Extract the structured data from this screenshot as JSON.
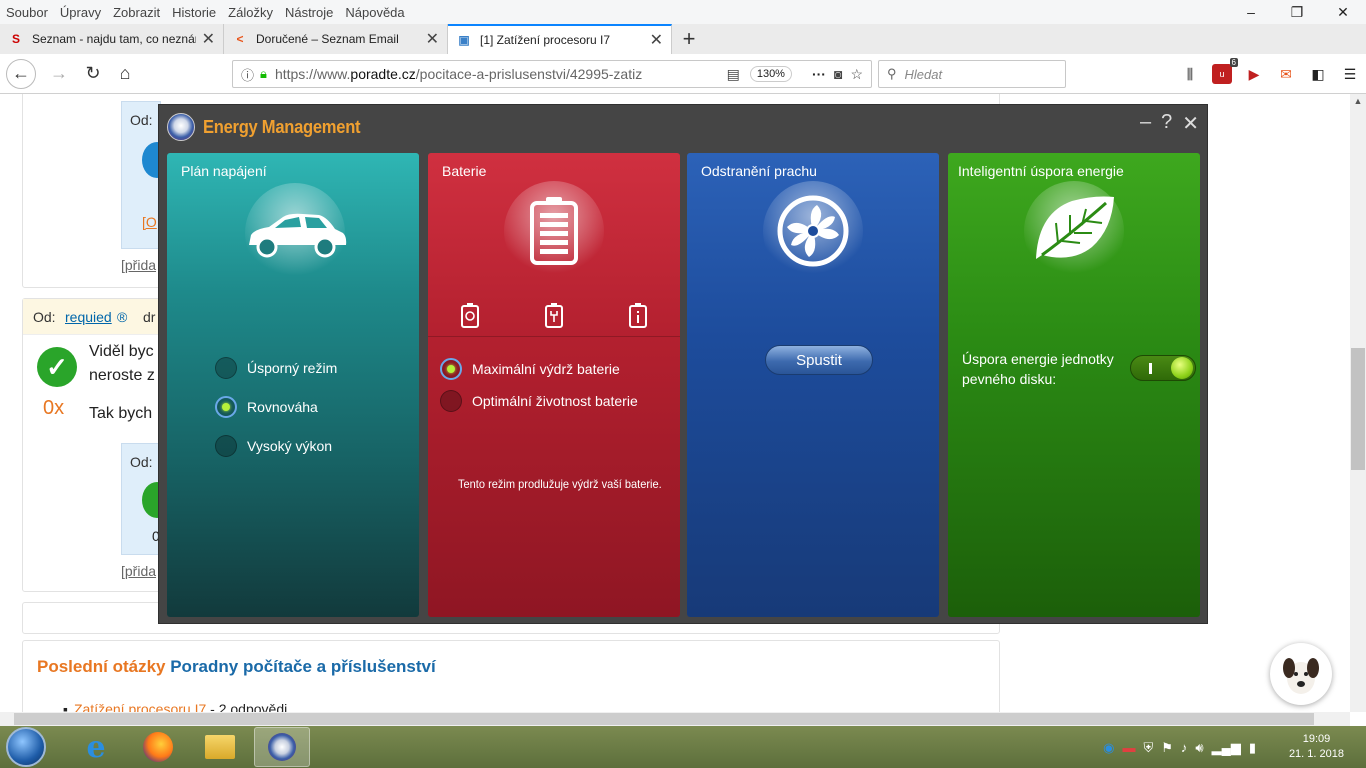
{
  "menubar": {
    "items": [
      "Soubor",
      "Úpravy",
      "Zobrazit",
      "Historie",
      "Záložky",
      "Nástroje",
      "Nápověda"
    ]
  },
  "window_controls": {
    "minimize": "–",
    "maximize": "❐",
    "close": "✕"
  },
  "tabs": [
    {
      "title": "Seznam - najdu tam, co neznám",
      "icon": "S",
      "icon_color": "#cc0000",
      "active": false
    },
    {
      "title": "Doručené – Seznam Email",
      "icon": "<",
      "icon_color": "#e8541a",
      "active": false
    },
    {
      "title": "[1] Zatížení procesoru I7",
      "icon": "▣",
      "icon_color": "#3a80c8",
      "active": true
    }
  ],
  "navbar": {
    "url_prefix": "https://www.",
    "url_host": "poradte.cz",
    "url_path": "/pocitace-a-prislusenstvi/42995-zatiz",
    "zoom": "130%",
    "search_placeholder": "Hledat",
    "badge": "6"
  },
  "page": {
    "od_label": "Od:",
    "link_o": "[O",
    "pridat": "[přida",
    "user": "requied",
    "user_mark": "®",
    "dr": "dr",
    "post_text1": "Viděl byc",
    "post_text2": "neroste z",
    "post_text3": "Tak bych",
    "score": "0x",
    "zero": "0",
    "section_title_a": "Poslední otázky",
    "section_title_b": "Poradny počítače a příslušenství",
    "list_item_link": "Zatížení procesoru I7",
    "list_item_rest": " - 2 odpovědi"
  },
  "energy": {
    "title": "Energy Management",
    "controls": {
      "min": "–",
      "help": "?",
      "close": "✕"
    },
    "plan": {
      "title": "Plán napájení",
      "options": [
        {
          "label": "Úsporný režim",
          "selected": false
        },
        {
          "label": "Rovnováha",
          "selected": true
        },
        {
          "label": "Vysoký výkon",
          "selected": false
        }
      ]
    },
    "battery": {
      "title": "Baterie",
      "options": [
        {
          "label": "Maximální výdrž baterie",
          "selected": true
        },
        {
          "label": "Optimální životnost baterie",
          "selected": false
        }
      ],
      "hint": "Tento režim prodlužuje výdrž vaší baterie."
    },
    "dust": {
      "title": "Odstranění prachu",
      "button": "Spustit"
    },
    "smart": {
      "title": "Inteligentní úspora energie",
      "hdd_label": "Úspora energie jednotky pevného disku:",
      "toggle_on": true
    }
  },
  "taskbar": {
    "time": "19:09",
    "date": "21. 1. 2018"
  },
  "colors": {
    "accent_orange": "#f0a030",
    "link_blue": "#0066aa",
    "firefox_blue": "#0a84ff"
  }
}
